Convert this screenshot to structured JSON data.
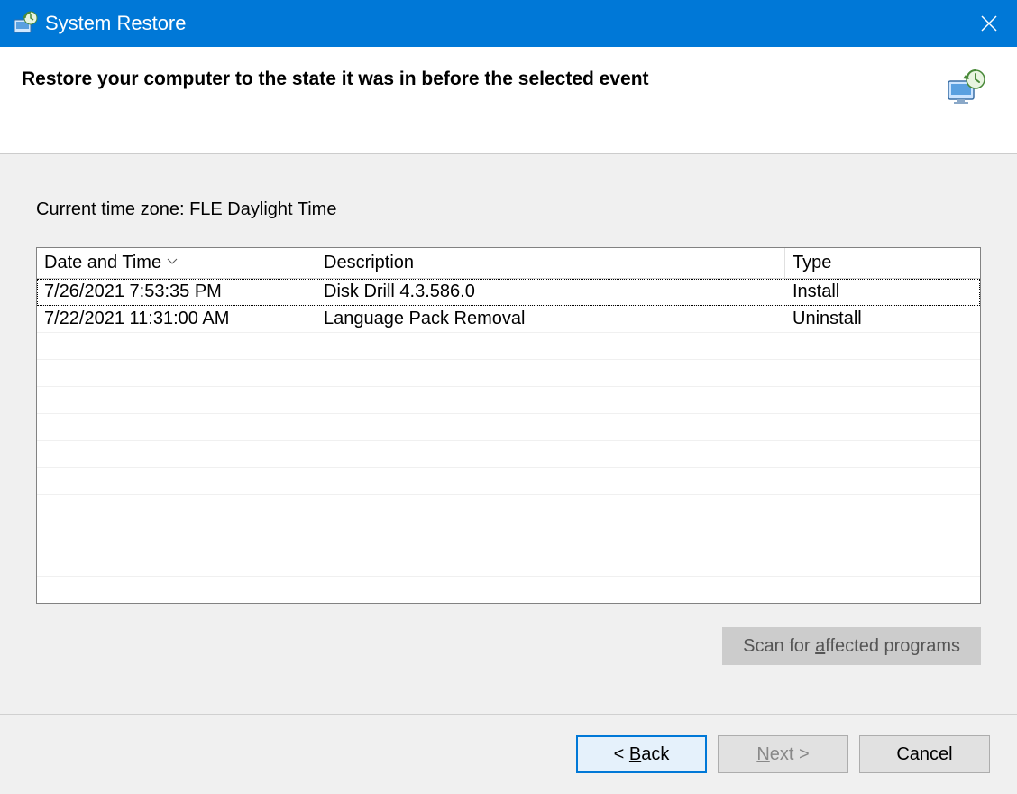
{
  "titlebar": {
    "title": "System Restore"
  },
  "header": {
    "text": "Restore your computer to the state it was in before the selected event"
  },
  "content": {
    "timezone_label": "Current time zone: FLE Daylight Time",
    "columns": {
      "date": "Date and Time",
      "desc": "Description",
      "type": "Type"
    },
    "rows": [
      {
        "date": "7/26/2021 7:53:35 PM",
        "desc": "Disk Drill 4.3.586.0",
        "type": "Install"
      },
      {
        "date": "7/22/2021 11:31:00 AM",
        "desc": "Language Pack Removal",
        "type": "Uninstall"
      }
    ],
    "scan_button": "Scan for affected programs"
  },
  "footer": {
    "back": "Back",
    "next": "Next",
    "cancel": "Cancel"
  }
}
